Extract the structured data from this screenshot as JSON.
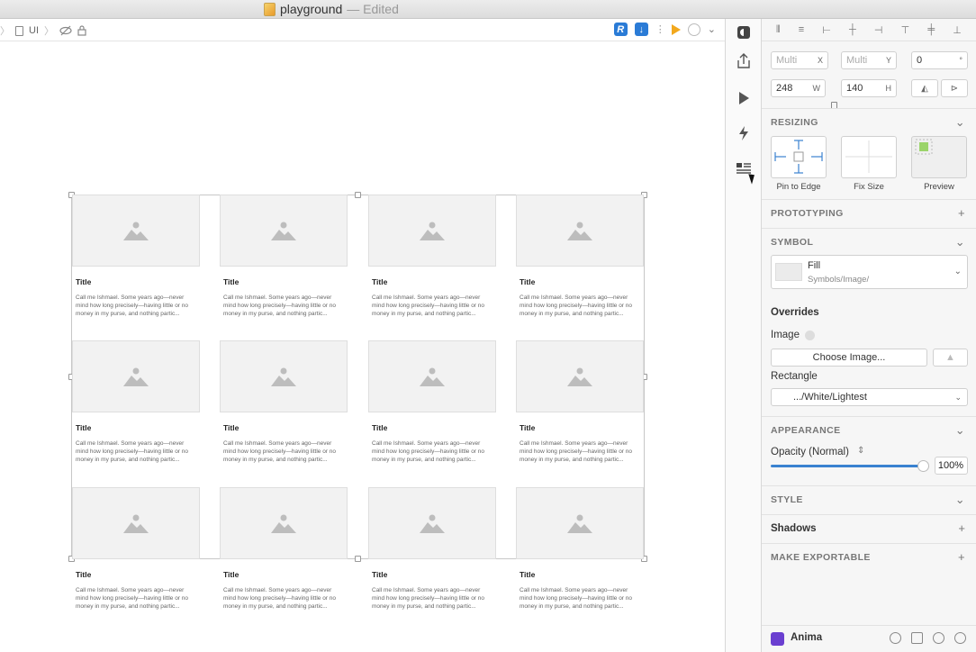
{
  "window": {
    "title": "playground",
    "status": "— Edited"
  },
  "breadcrumb": {
    "item": "UI"
  },
  "canvas": {
    "cells": [
      {
        "title": "Title",
        "body": "Call me Ishmael. Some years ago—never mind how long precisely—having little or no money in my purse, and nothing partic..."
      },
      {
        "title": "Title",
        "body": "Call me Ishmael. Some years ago—never mind how long precisely—having little or no money in my purse, and nothing partic..."
      },
      {
        "title": "Title",
        "body": "Call me Ishmael. Some years ago—never mind how long precisely—having little or no money in my purse, and nothing partic..."
      },
      {
        "title": "Title",
        "body": "Call me Ishmael. Some years ago—never mind how long precisely—having little or no money in my purse, and nothing partic..."
      },
      {
        "title": "Title",
        "body": "Call me Ishmael. Some years ago—never mind how long precisely—having little or no money in my purse, and nothing partic..."
      },
      {
        "title": "Title",
        "body": "Call me Ishmael. Some years ago—never mind how long precisely—having little or no money in my purse, and nothing partic..."
      },
      {
        "title": "Title",
        "body": "Call me Ishmael. Some years ago—never mind how long precisely—having little or no money in my purse, and nothing partic..."
      },
      {
        "title": "Title",
        "body": "Call me Ishmael. Some years ago—never mind how long precisely—having little or no money in my purse, and nothing partic..."
      },
      {
        "title": "Title",
        "body": "Call me Ishmael. Some years ago—never mind how long precisely—having little or no money in my purse, and nothing partic..."
      },
      {
        "title": "Title",
        "body": "Call me Ishmael. Some years ago—never mind how long precisely—having little or no money in my purse, and nothing partic..."
      },
      {
        "title": "Title",
        "body": "Call me Ishmael. Some years ago—never mind how long precisely—having little or no money in my purse, and nothing partic..."
      },
      {
        "title": "Title",
        "body": "Call me Ishmael. Some years ago—never mind how long precisely—having little or no money in my purse, and nothing partic..."
      }
    ]
  },
  "inspector": {
    "position": {
      "x_placeholder": "Multi",
      "x_label": "X",
      "y_placeholder": "Multi",
      "y_label": "Y",
      "rotation": "0",
      "rotation_unit": "°"
    },
    "size": {
      "width": "248",
      "width_label": "W",
      "height": "140",
      "height_label": "H"
    },
    "resizing": {
      "header": "RESIZING",
      "options": [
        "Pin to Edge",
        "Fix Size",
        "Preview"
      ]
    },
    "prototyping": {
      "header": "PROTOTYPING"
    },
    "symbol": {
      "header": "SYMBOL",
      "name": "Fill",
      "path": "Symbols/Image/"
    },
    "overrides": {
      "header": "Overrides",
      "image_label": "Image",
      "choose_image": "Choose Image...",
      "rectangle_label": "Rectangle",
      "rectangle_value": ".../White/Lightest"
    },
    "appearance": {
      "header": "APPEARANCE",
      "opacity_label": "Opacity (Normal)",
      "opacity_value": "100%",
      "opacity_fraction": 1.0
    },
    "style": {
      "header": "STYLE"
    },
    "shadows": {
      "header": "Shadows"
    },
    "exportable": {
      "header": "MAKE EXPORTABLE"
    },
    "plugin": {
      "name": "Anima"
    }
  },
  "colors": {
    "accent": "#3a82d0",
    "anima": "#6a3fd0",
    "prototype_play": "#f2a81d"
  }
}
